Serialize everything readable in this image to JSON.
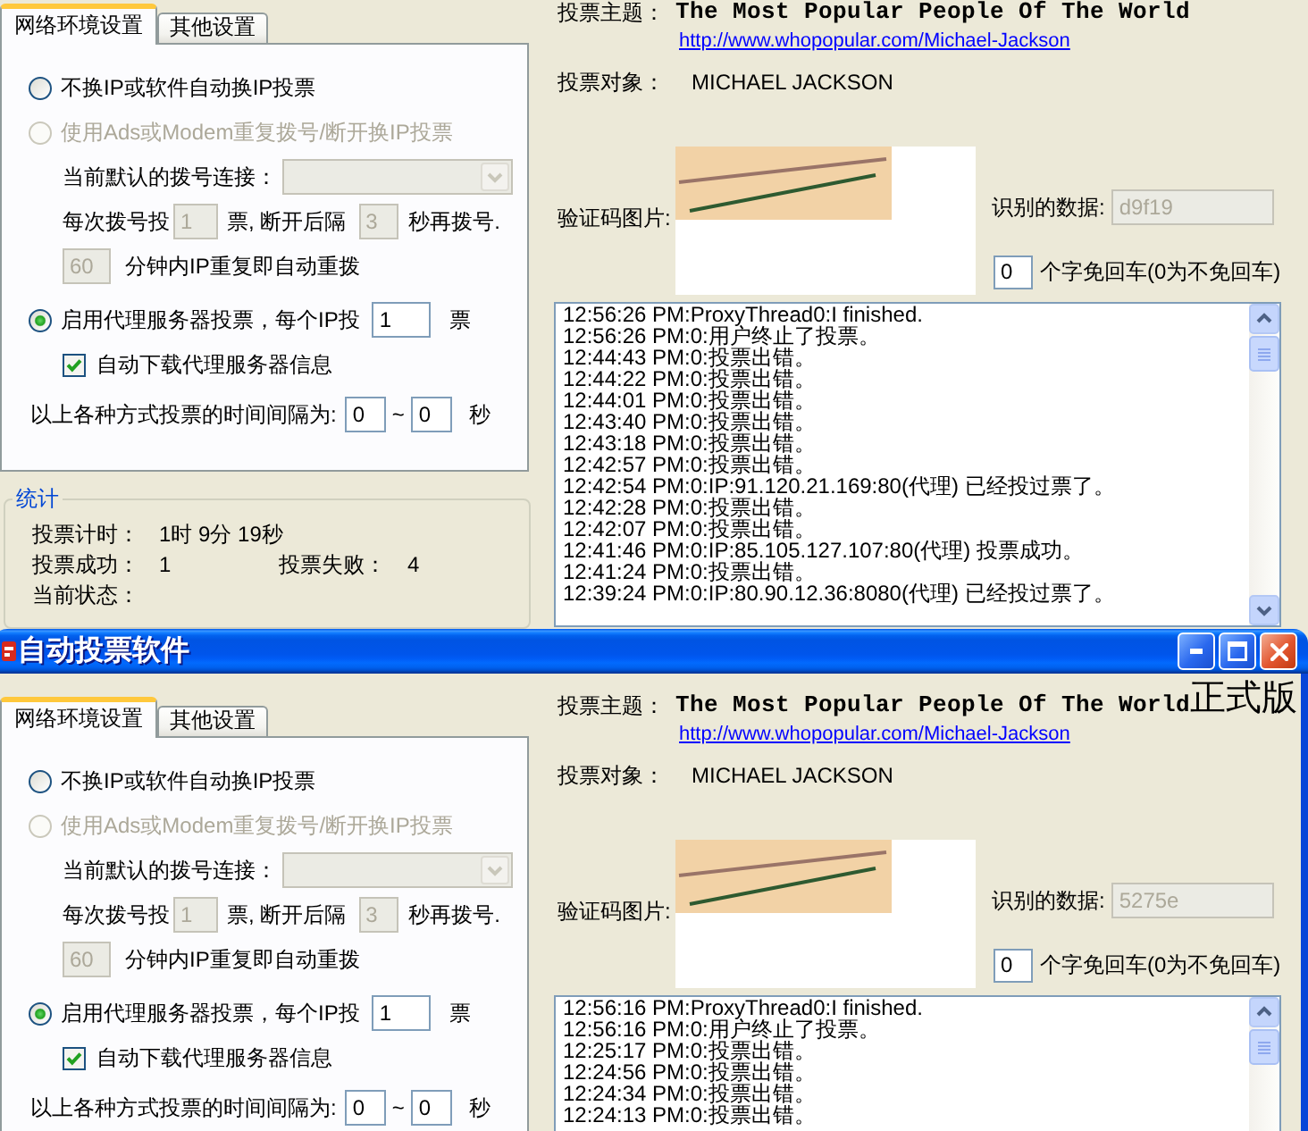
{
  "windows": [
    {
      "tabs": [
        {
          "label": "网络环境设置",
          "selected": true
        },
        {
          "label": "其他设置",
          "selected": false
        }
      ],
      "modes": [
        {
          "kind": "direct",
          "label": "不换IP或软件自动换IP投票",
          "selected": false,
          "disabled": false
        },
        {
          "kind": "dialup",
          "label": "使用Ads或Modem重复拨号/断开换IP投票",
          "selected": false,
          "disabled": true,
          "connection_label": "当前默认的拨号连接：",
          "votes_label": "每次拨号投",
          "votes": "1",
          "pause_label": "票, 断开后隔",
          "pause": "3",
          "redial_label": "秒再拨号.",
          "minutes": "60",
          "minutes_label": "分钟内IP重复即自动重拨"
        },
        {
          "kind": "proxy",
          "label": "启用代理服务器投票，每个IP投",
          "selected": true,
          "disabled": false,
          "votes": "1",
          "unit": "票",
          "auto_download": {
            "label": "自动下载代理服务器信息",
            "checked": true
          }
        }
      ],
      "interval": {
        "label": "以上各种方式投票的时间间隔为:",
        "from": "0",
        "separator": "~",
        "to": "0",
        "unit": "秒"
      },
      "stats": {
        "title": "统计",
        "timer_label": "投票计时：",
        "timer": "1时 9分 19秒",
        "success_label": "投票成功：",
        "success": "1",
        "failure_label": "投票失败：",
        "failure": "4",
        "status_label": "当前状态："
      },
      "vote": {
        "subject_label": "投票主题：",
        "subject": "The Most Popular People Of The World",
        "url": "http://www.whopopular.com/Michael-Jackson",
        "target_label": "投票对象：",
        "target": "MICHAEL JACKSON",
        "captcha_label": "验证码图片:",
        "recognized": {
          "label": "识别的数据:",
          "value": "d9f19",
          "disabled": true
        },
        "auto_enter": {
          "value": "0",
          "label": "个字免回车(0为不免回车)"
        }
      },
      "log": [
        "12:56:26 PM:ProxyThread0:I finished.",
        "12:56:26 PM:0:用户终止了投票。",
        "12:44:43 PM:0:投票出错。",
        "12:44:22 PM:0:投票出错。",
        "12:44:01 PM:0:投票出错。",
        "12:43:40 PM:0:投票出错。",
        "12:43:18 PM:0:投票出错。",
        "12:42:57 PM:0:投票出错。",
        "12:42:54 PM:0:IP:91.120.21.169:80(代理) 已经投过票了。",
        "12:42:28 PM:0:投票出错。",
        "12:42:07 PM:0:投票出错。",
        "12:41:46 PM:0:IP:85.105.127.107:80(代理) 投票成功。",
        "12:41:24 PM:0:投票出错。",
        "12:39:24 PM:0:IP:80.90.12.36:8080(代理) 已经投过票了。"
      ]
    },
    {
      "title": "自动投票软件",
      "tabs": [
        {
          "label": "网络环境设置",
          "selected": true
        },
        {
          "label": "其他设置",
          "selected": false
        }
      ],
      "modes": [
        {
          "kind": "direct",
          "label": "不换IP或软件自动换IP投票",
          "selected": false,
          "disabled": false
        },
        {
          "kind": "dialup",
          "label": "使用Ads或Modem重复拨号/断开换IP投票",
          "selected": false,
          "disabled": true,
          "connection_label": "当前默认的拨号连接：",
          "votes_label": "每次拨号投",
          "votes": "1",
          "pause_label": "票, 断开后隔",
          "pause": "3",
          "redial_label": "秒再拨号.",
          "minutes": "60",
          "minutes_label": "分钟内IP重复即自动重拨"
        },
        {
          "kind": "proxy",
          "label": "启用代理服务器投票，每个IP投",
          "selected": true,
          "disabled": false,
          "votes": "1",
          "unit": "票",
          "auto_download": {
            "label": "自动下载代理服务器信息",
            "checked": true
          }
        }
      ],
      "interval": {
        "label": "以上各种方式投票的时间间隔为:",
        "from": "0",
        "separator": "~",
        "to": "0",
        "unit": "秒"
      },
      "vote": {
        "subject_label": "投票主题：",
        "subject": "The Most Popular People Of The World",
        "edition": "正式版",
        "url": "http://www.whopopular.com/Michael-Jackson",
        "target_label": "投票对象：",
        "target": "MICHAEL JACKSON",
        "captcha_label": "验证码图片:",
        "recognized": {
          "label": "识别的数据:",
          "value": "5275e",
          "disabled": true
        },
        "auto_enter": {
          "value": "0",
          "label": "个字免回车(0为不免回车)"
        }
      },
      "log": [
        "12:56:16 PM:ProxyThread0:I finished.",
        "12:56:16 PM:0:用户终止了投票。",
        "12:25:17 PM:0:投票出错。",
        "12:24:56 PM:0:投票出错。",
        "12:24:34 PM:0:投票出错。",
        "12:24:13 PM:0:投票出错。"
      ]
    }
  ]
}
